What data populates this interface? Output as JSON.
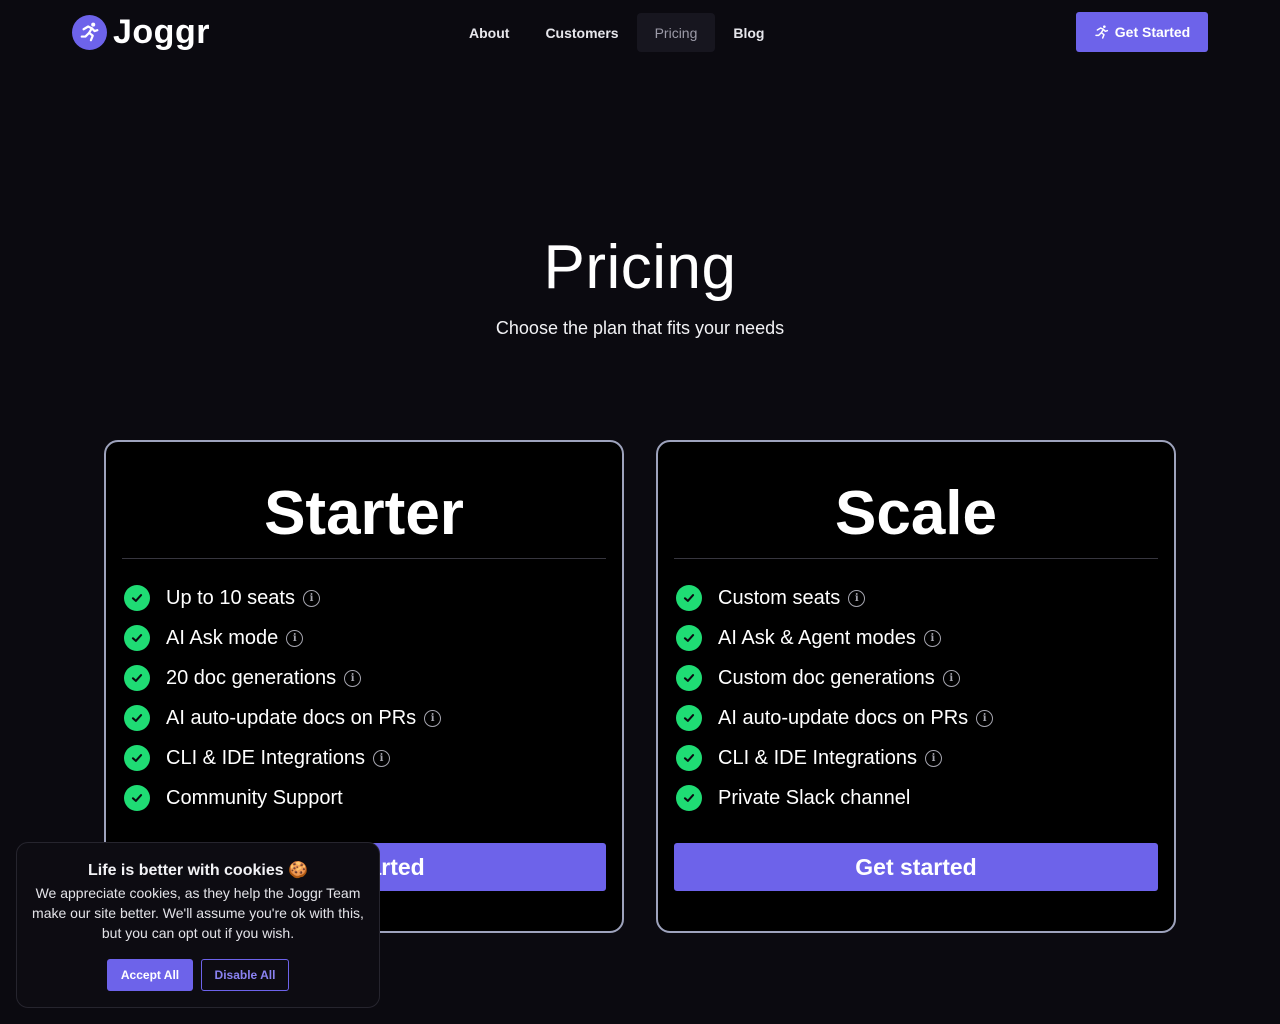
{
  "brand": {
    "name": "Joggr",
    "icon": "runner-icon",
    "accent_color": "#6d63ea"
  },
  "nav": {
    "items": [
      {
        "label": "About",
        "active": false
      },
      {
        "label": "Customers",
        "active": false
      },
      {
        "label": "Pricing",
        "active": true
      },
      {
        "label": "Blog",
        "active": false
      }
    ],
    "cta_label": "Get Started"
  },
  "hero": {
    "title": "Pricing",
    "subtitle": "Choose the plan that fits your needs"
  },
  "plans": [
    {
      "name": "Starter",
      "features": [
        {
          "label": "Up to 10 seats",
          "info": true
        },
        {
          "label": "AI Ask mode",
          "info": true
        },
        {
          "label": "20 doc generations",
          "info": true
        },
        {
          "label": "AI auto-update docs on PRs",
          "info": true
        },
        {
          "label": "CLI & IDE Integrations",
          "info": true
        },
        {
          "label": "Community Support",
          "info": false
        }
      ],
      "button_label": "Get started"
    },
    {
      "name": "Scale",
      "features": [
        {
          "label": "Custom seats",
          "info": true
        },
        {
          "label": "AI Ask & Agent modes",
          "info": true
        },
        {
          "label": "Custom doc generations",
          "info": true
        },
        {
          "label": "AI auto-update docs on PRs",
          "info": true
        },
        {
          "label": "CLI & IDE Integrations",
          "info": true
        },
        {
          "label": "Private Slack channel",
          "info": false
        }
      ],
      "button_label": "Get started"
    }
  ],
  "cookie_banner": {
    "title": "Life is better with cookies 🍪",
    "text": "We appreciate cookies, as they help the Joggr Team make our site better. We'll assume you're ok with this, but you can opt out if you wish.",
    "accept_label": "Accept All",
    "disable_label": "Disable All"
  },
  "colors": {
    "background": "#0b0a10",
    "check": "#1fdc74",
    "card_border": "#9ea3bd"
  }
}
